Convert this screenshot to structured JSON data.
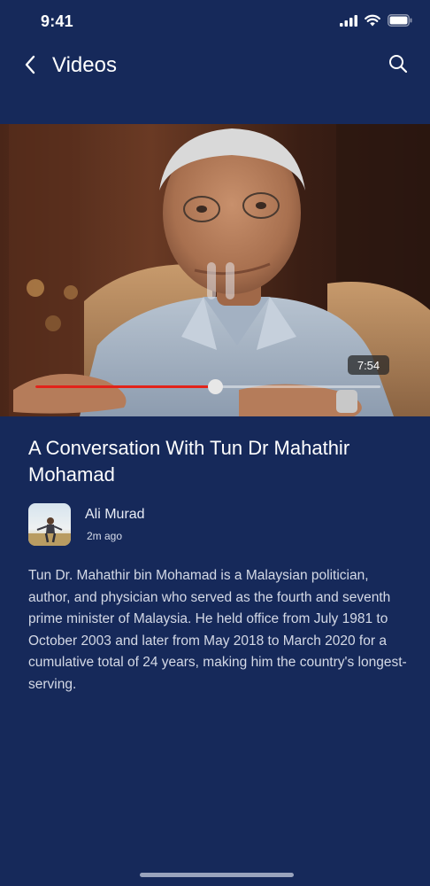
{
  "status_bar": {
    "time": "9:41"
  },
  "header": {
    "title": "Videos",
    "back_icon": "chevron-left-icon",
    "search_icon": "search-icon"
  },
  "video": {
    "duration": "7:54",
    "progress_fraction": 0.52,
    "state_icon": "pause-icon"
  },
  "article": {
    "title": "A Conversation With Tun Dr Mahathir Mohamad",
    "author": "Ali Murad",
    "posted": "2m ago",
    "description": "Tun Dr. Mahathir bin Mohamad is a Malaysian politician, author, and physician who served as the fourth and seventh prime minister of Malaysia. He held office from July 1981 to October 2003 and later from May 2018 to March 2020 for a cumulative total of 24 years, making him the country's longest-serving."
  },
  "colors": {
    "background": "#16295a",
    "progress": "#e2231a"
  }
}
